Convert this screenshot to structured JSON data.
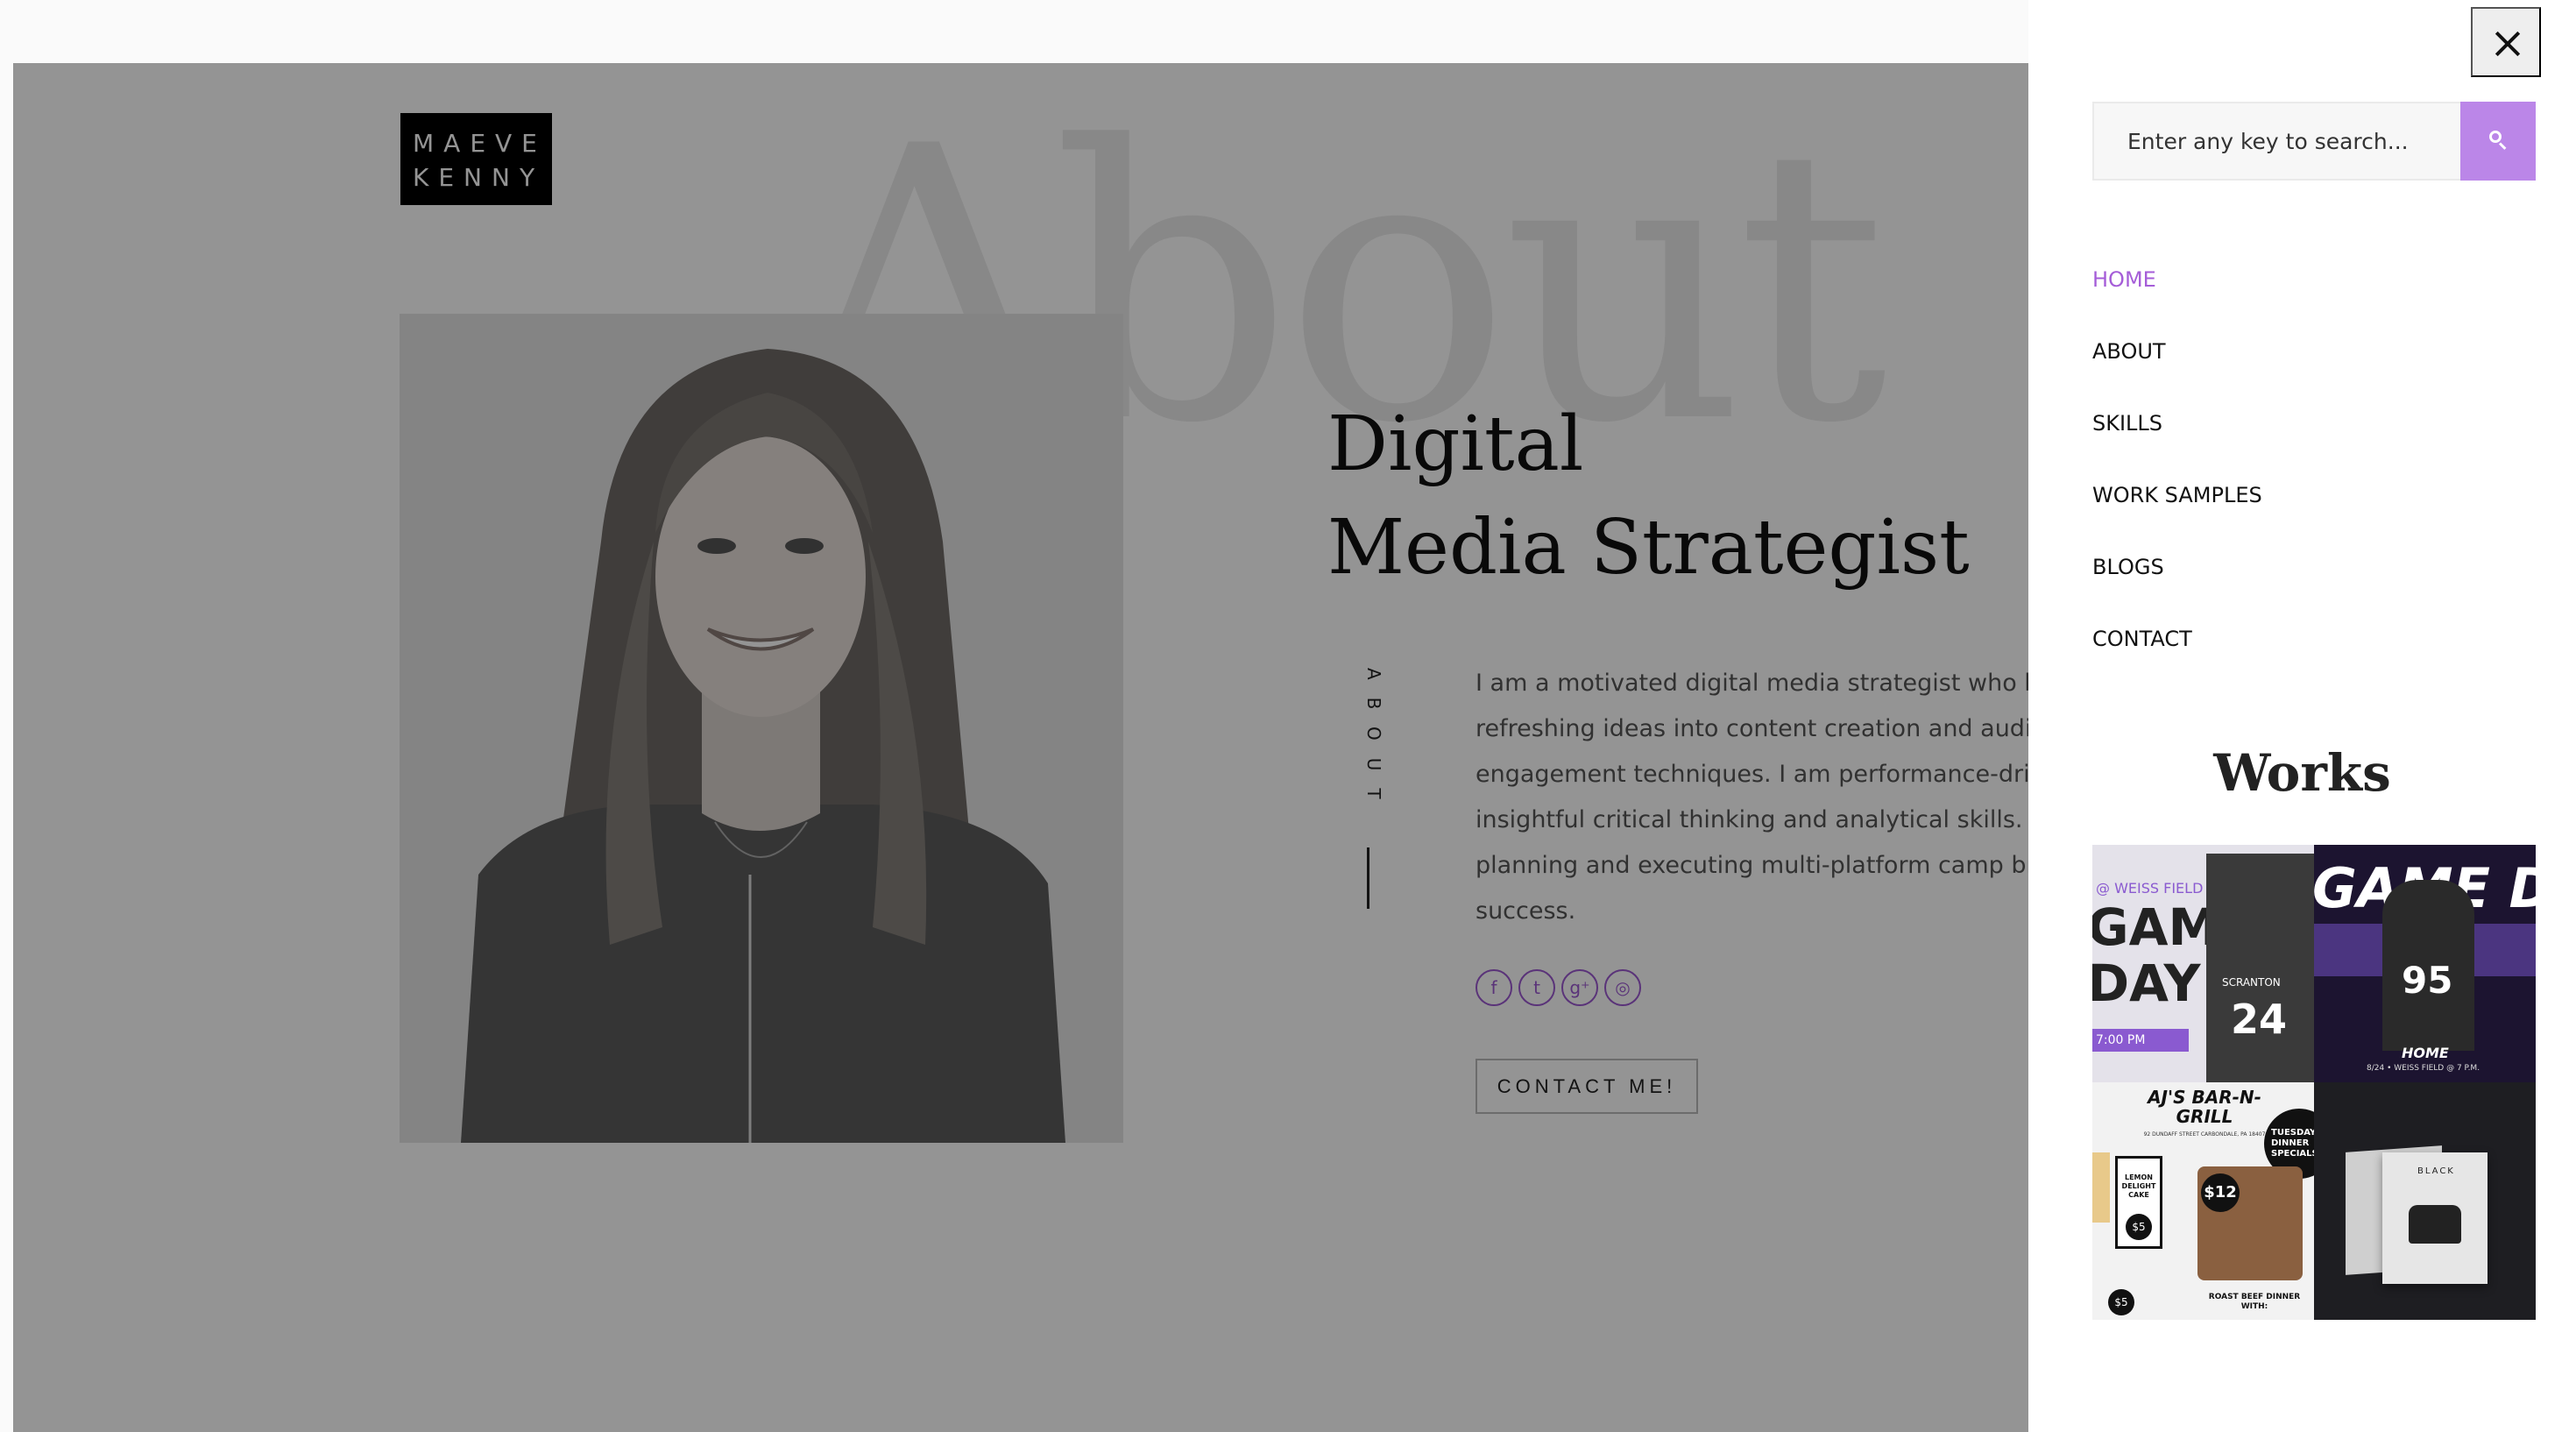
{
  "logo": {
    "line1": "MAEVE",
    "line2": "KENNY"
  },
  "hero": {
    "background_word": "About",
    "title_line1": "Digital",
    "title_line2": "Media Strategist",
    "vertical_label": "ABOUT",
    "paragraph": "I am a motivated digital media strategist who bri refreshing ideas into content creation and audie engagement techniques. I am performance-drive insightful critical thinking and analytical skills. in planning and executing multi-platform camp brand success.",
    "social_icons": [
      "facebook-icon",
      "twitter-icon",
      "google-plus-icon",
      "dribbble-icon"
    ],
    "contact_button": "CONTACT ME!"
  },
  "panel": {
    "search_placeholder": "Enter any key to search...",
    "nav": [
      {
        "label": "HOME",
        "active": true
      },
      {
        "label": "ABOUT",
        "active": false
      },
      {
        "label": "SKILLS",
        "active": false
      },
      {
        "label": "WORK SAMPLES",
        "active": false
      },
      {
        "label": "BLOGS",
        "active": false
      },
      {
        "label": "CONTACT",
        "active": false
      }
    ],
    "works_title": "Works",
    "works": [
      {
        "headline": "GAME DAY",
        "sub": "@ WEISS FIELD",
        "time": "7:00 PM",
        "jersey": "24",
        "team": "SCRANTON"
      },
      {
        "headline": "GAME DAY",
        "jersey": "95",
        "tag": "HOME",
        "sub": "8/24 • WEISS FIELD @ 7 P.M."
      },
      {
        "headline": "AJ'S BAR-N-GRILL",
        "address": "92 DUNDAFF STREET CARBONDALE, PA 18407",
        "badge": "TUESDAY DINNER SPECIALS",
        "cake": "LEMON DELIGHT CAKE",
        "price1": "$5",
        "price2": "$12",
        "price3": "$5",
        "dinner": "ROAST BEEF DINNER WITH:"
      },
      {
        "brand": "BLACK"
      }
    ]
  },
  "colors": {
    "accent": "#a55dd8",
    "search_button": "#bb86e8",
    "overlay": "rgba(0,0,0,0.42)"
  }
}
